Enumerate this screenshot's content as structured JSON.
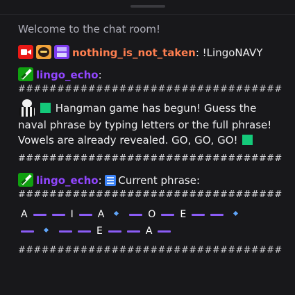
{
  "chat": {
    "welcome": "Welcome to the chat room!",
    "messages": [
      {
        "badges": [
          "live-camera-badge",
          "bomber-face-badge",
          "purple-grid-badge"
        ],
        "username": "nothing_is_not_taken",
        "separator": ": ",
        "text": "!LingoNAVY",
        "color": "#ff7f50"
      },
      {
        "badges": [
          "green-sword-badge"
        ],
        "username": "lingo_echo",
        "separator": ":",
        "color": "#9146ff"
      }
    ],
    "rule": "##################################",
    "announcement": {
      "line1": "Hangman game has begun! Guess the",
      "line2": "naval phrase by typing letters or the full phrase!",
      "line3": "Vowels are already revealed. GO, GO, GO!"
    },
    "phrase_message": {
      "username": "lingo_echo",
      "separator": ":",
      "text": "Current phrase:",
      "row1": [
        "A",
        "_",
        "_",
        "I",
        "_",
        "A",
        " ",
        "_",
        "O",
        "_",
        "E",
        "_",
        "_",
        " "
      ],
      "row2": [
        "_",
        " ",
        "_",
        "_",
        "E",
        "_",
        "_",
        "A",
        "_"
      ]
    }
  },
  "colors": {
    "background": "#18181b",
    "username_orange": "#ff7f50",
    "username_purple": "#9146ff",
    "dash": "#8b5cf6",
    "green_square": "#14c97a"
  }
}
